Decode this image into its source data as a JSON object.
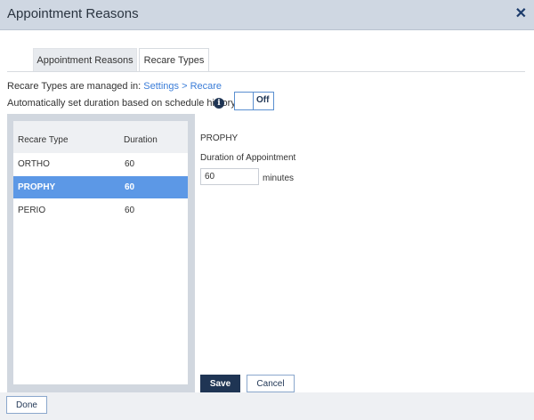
{
  "window": {
    "title": "Appointment Reasons",
    "close_icon": "close-icon"
  },
  "tabs": [
    {
      "label": "Appointment Reasons",
      "active": false
    },
    {
      "label": "Recare Types",
      "active": true
    }
  ],
  "managed": {
    "prefix": "Recare Types are managed in: ",
    "link": "Settings > Recare"
  },
  "auto_duration": {
    "label": "Automatically set duration based on schedule history",
    "info_icon": "info-icon",
    "toggle_state": "Off"
  },
  "list": {
    "headers": {
      "type": "Recare Type",
      "duration": "Duration"
    },
    "rows": [
      {
        "type": "ORTHO",
        "duration": "60",
        "selected": false
      },
      {
        "type": "PROPHY",
        "duration": "60",
        "selected": true
      },
      {
        "type": "PERIO",
        "duration": "60",
        "selected": false
      }
    ]
  },
  "detail": {
    "title": "PROPHY",
    "duration_label": "Duration of Appointment",
    "duration_value": "60",
    "units": "minutes"
  },
  "actions": {
    "save": "Save",
    "cancel": "Cancel"
  },
  "footer": {
    "done": "Done"
  },
  "colors": {
    "accent": "#5c98e6",
    "primary": "#1f3554",
    "header_bg": "#cfd7e2",
    "link": "#3b7dd8"
  }
}
